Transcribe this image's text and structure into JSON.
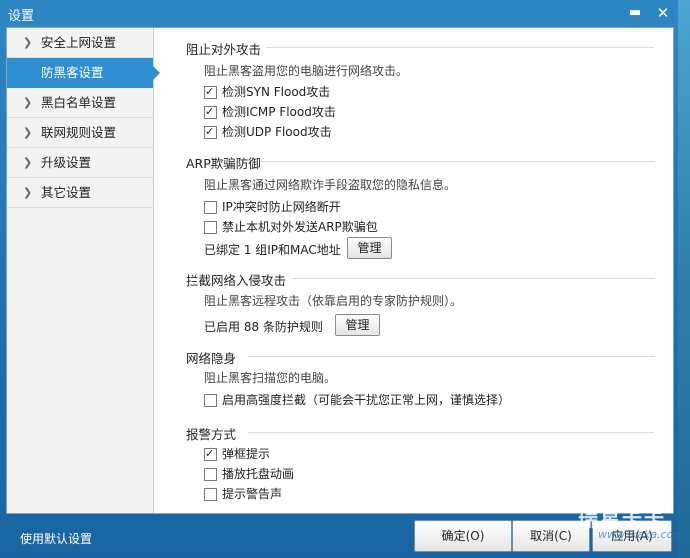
{
  "window": {
    "title": "设置"
  },
  "titlebar": {
    "minimize": "▬",
    "close": "✕"
  },
  "sidebar": {
    "items": [
      {
        "label": "安全上网设置",
        "active": false
      },
      {
        "label": "防黑客设置",
        "active": true
      },
      {
        "label": "黑白名单设置",
        "active": false
      },
      {
        "label": "联网规则设置",
        "active": false
      },
      {
        "label": "升级设置",
        "active": false
      },
      {
        "label": "其它设置",
        "active": false
      }
    ],
    "chevron": "❯"
  },
  "sections": {
    "external_attack": {
      "title": "阻止对外攻击",
      "desc": "阻止黑客盗用您的电脑进行网络攻击。",
      "options": [
        {
          "label": "检测SYN Flood攻击",
          "checked": true
        },
        {
          "label": "检测ICMP Flood攻击",
          "checked": true
        },
        {
          "label": "检测UDP Flood攻击",
          "checked": true
        }
      ]
    },
    "arp": {
      "title": "ARP欺骗防御",
      "desc": "阻止黑客通过网络欺诈手段盗取您的隐私信息。",
      "options": [
        {
          "label": "IP冲突时防止网络断开",
          "checked": false
        },
        {
          "label": "禁止本机对外发送ARP欺骗包",
          "checked": false
        }
      ],
      "bound_text": "已绑定 1 组IP和MAC地址",
      "manage_label": "管理"
    },
    "intrusion": {
      "title": "拦截网络入侵攻击",
      "desc": "阻止黑客远程攻击（依靠启用的专家防护规则）。",
      "rules_text": "已启用 88 条防护规则",
      "manage_label": "管理"
    },
    "stealth": {
      "title": "网络隐身",
      "desc": "阻止黑客扫描您的电脑。",
      "options": [
        {
          "label": "启用高强度拦截（可能会干扰您正常上网，谨慎选择）",
          "checked": false
        }
      ]
    },
    "alert": {
      "title": "报警方式",
      "options": [
        {
          "label": "弹框提示",
          "checked": true
        },
        {
          "label": "播放托盘动画",
          "checked": false
        },
        {
          "label": "提示警告声",
          "checked": false
        }
      ]
    }
  },
  "footer": {
    "defaults_link": "使用默认设置",
    "ok_label": "确定(O)",
    "cancel_label": "取消(C)",
    "apply_label": "应用(A)"
  },
  "watermark": {
    "brand": "瑞星卡卡",
    "url": "www.ikaka.com"
  },
  "colors": {
    "accent": "#2f8fd0",
    "titlebar": "#2f87c4"
  }
}
